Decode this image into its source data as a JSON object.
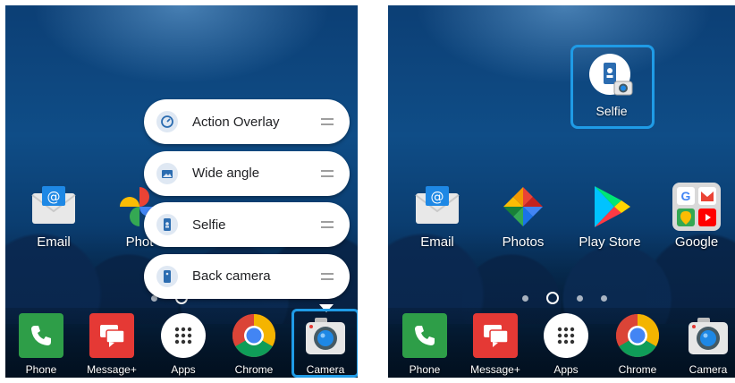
{
  "colors": {
    "highlight": "#1f9be6",
    "menu_bg": "#ffffff",
    "menu_text": "#202124"
  },
  "left_screen": {
    "home_apps": [
      {
        "label": "Email",
        "icon": "email-icon"
      },
      {
        "label": "Phot",
        "icon": "photos-icon"
      }
    ],
    "shortcut_menu": [
      {
        "label": "Action Overlay",
        "icon": "action-overlay-icon"
      },
      {
        "label": "Wide angle",
        "icon": "wide-angle-icon"
      },
      {
        "label": "Selfie",
        "icon": "selfie-icon"
      },
      {
        "label": "Back camera",
        "icon": "back-camera-icon"
      }
    ],
    "dock": [
      {
        "label": "Phone",
        "icon": "phone-icon"
      },
      {
        "label": "Message+",
        "icon": "message-plus-icon"
      },
      {
        "label": "Apps",
        "icon": "apps-grid-icon"
      },
      {
        "label": "Chrome",
        "icon": "chrome-icon"
      },
      {
        "label": "Camera",
        "icon": "camera-icon"
      }
    ]
  },
  "right_screen": {
    "pinned_shortcut": {
      "label": "Selfie",
      "icon": "selfie-shortcut-icon"
    },
    "home_apps": [
      {
        "label": "Email",
        "icon": "email-icon"
      },
      {
        "label": "Photos",
        "icon": "photos-icon"
      },
      {
        "label": "Play Store",
        "icon": "play-store-icon"
      },
      {
        "label": "Google",
        "icon": "google-folder-icon"
      }
    ],
    "dock": [
      {
        "label": "Phone",
        "icon": "phone-icon"
      },
      {
        "label": "Message+",
        "icon": "message-plus-icon"
      },
      {
        "label": "Apps",
        "icon": "apps-grid-icon"
      },
      {
        "label": "Chrome",
        "icon": "chrome-icon"
      },
      {
        "label": "Camera",
        "icon": "camera-icon"
      }
    ]
  }
}
